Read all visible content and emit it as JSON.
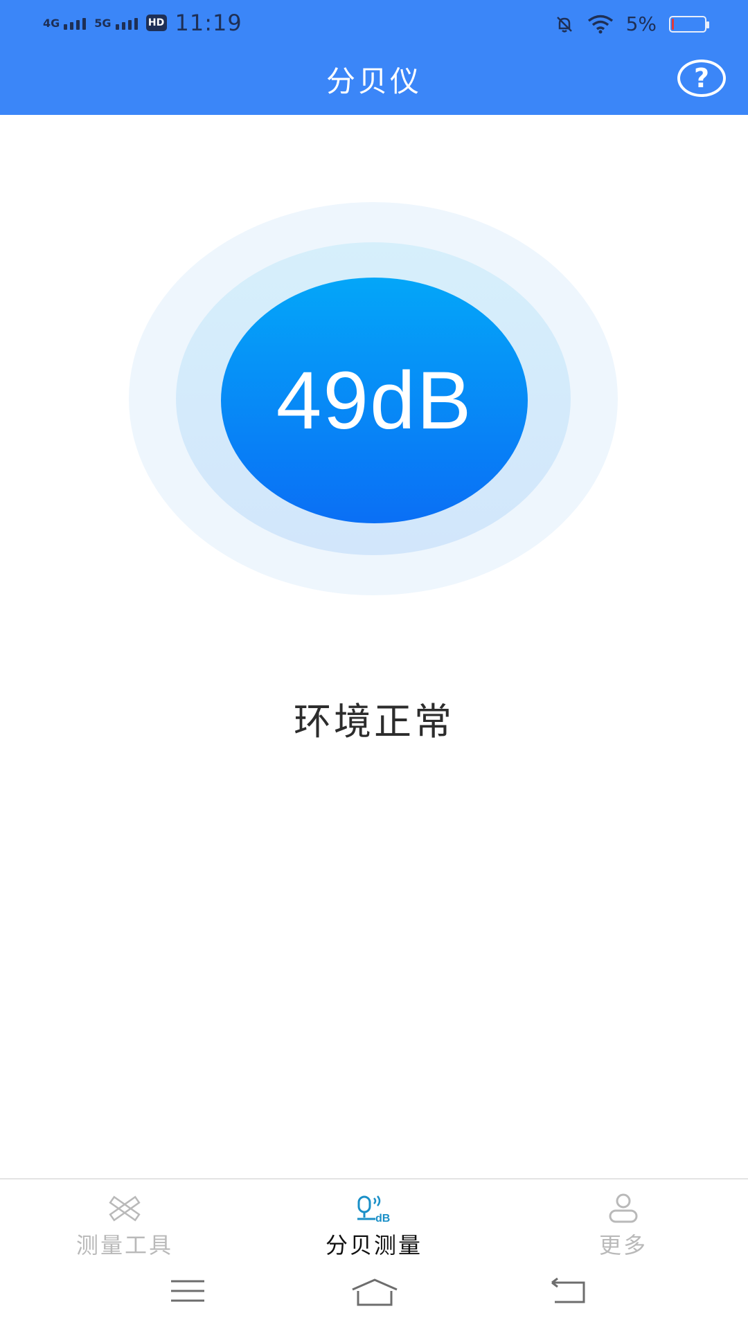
{
  "status_bar": {
    "net1": "4G",
    "net2": "5G",
    "hd": "HD",
    "time": "11:19",
    "battery_percent": "5%",
    "battery_level": 0.05,
    "battery_color": "#e23a3a",
    "icons": [
      "bell-off-icon",
      "wifi-icon",
      "battery-icon"
    ]
  },
  "header": {
    "title": "分贝仪",
    "help_icon": "?",
    "background": "#3b86f8"
  },
  "meter": {
    "reading": "49dB",
    "status": "环境正常",
    "accent": "#0a6ff5"
  },
  "bottom_nav": {
    "items": [
      {
        "label": "测量工具",
        "icon": "ruler-pencil-icon",
        "active": false
      },
      {
        "label": "分贝测量",
        "icon": "decibel-microphone-icon",
        "active": true
      },
      {
        "label": "更多",
        "icon": "person-icon",
        "active": false
      }
    ]
  },
  "system_nav": {
    "icons": [
      "menu-icon",
      "home-icon",
      "back-icon"
    ]
  }
}
